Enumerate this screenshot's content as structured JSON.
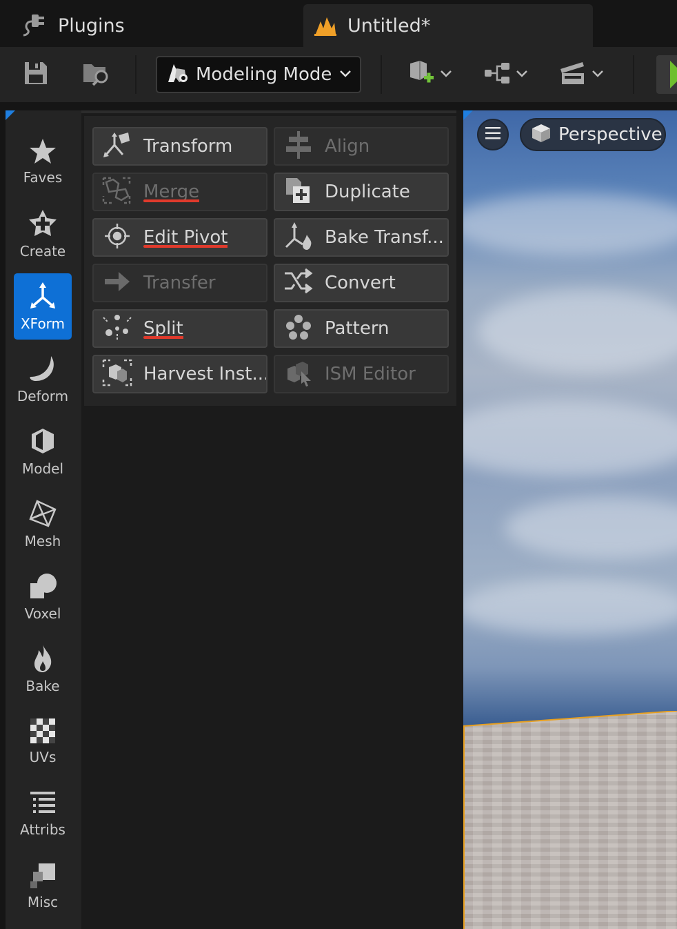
{
  "tabs": [
    {
      "label": "Plugins",
      "icon": "plugin-icon"
    },
    {
      "label": "Untitled*",
      "icon": "unreal-level-icon",
      "active": true
    }
  ],
  "toolbar": {
    "save_icon": "save-icon",
    "browse_icon": "content-browser-icon",
    "mode_label": "Modeling Mode",
    "mode_icon": "modeling-mode-icon",
    "add_actor_icon": "add-actor-icon",
    "blueprint_icon": "blueprint-icon",
    "cinematics_icon": "cinematics-icon",
    "play_icon": "play-icon",
    "accent_play": "#6fbf2e"
  },
  "categories": [
    {
      "label": "Faves",
      "icon": "star-icon"
    },
    {
      "label": "Create",
      "icon": "create-icon"
    },
    {
      "label": "XForm",
      "icon": "transform-axes-icon",
      "active": true
    },
    {
      "label": "Deform",
      "icon": "deform-icon"
    },
    {
      "label": "Model",
      "icon": "model-icon"
    },
    {
      "label": "Mesh",
      "icon": "mesh-icon"
    },
    {
      "label": "Voxel",
      "icon": "voxel-icon"
    },
    {
      "label": "Bake",
      "icon": "bake-flame-icon"
    },
    {
      "label": "UVs",
      "icon": "checker-icon"
    },
    {
      "label": "Attribs",
      "icon": "list-icon"
    },
    {
      "label": "Misc",
      "icon": "misc-icon"
    }
  ],
  "tools": [
    {
      "label": "Transform",
      "enabled": true,
      "underlined": false
    },
    {
      "label": "Align",
      "enabled": false,
      "underlined": false
    },
    {
      "label": "Merge",
      "enabled": false,
      "underlined": true
    },
    {
      "label": "Duplicate",
      "enabled": true,
      "underlined": false
    },
    {
      "label": "Edit Pivot",
      "enabled": true,
      "underlined": true
    },
    {
      "label": "Bake Transf...",
      "enabled": true,
      "underlined": false
    },
    {
      "label": "Transfer",
      "enabled": false,
      "underlined": false
    },
    {
      "label": "Convert",
      "enabled": true,
      "underlined": false
    },
    {
      "label": "Split",
      "enabled": true,
      "underlined": true
    },
    {
      "label": "Pattern",
      "enabled": true,
      "underlined": false
    },
    {
      "label": "Harvest Inst...",
      "enabled": true,
      "underlined": false
    },
    {
      "label": "ISM Editor",
      "enabled": false,
      "underlined": false
    }
  ],
  "viewport": {
    "view_label": "Perspective",
    "menu_icon": "hamburger-icon",
    "view_icon": "cube-icon"
  },
  "colors": {
    "accent": "#0e70d6",
    "underline": "#e03a2c",
    "level_icon": "#f0a028"
  }
}
